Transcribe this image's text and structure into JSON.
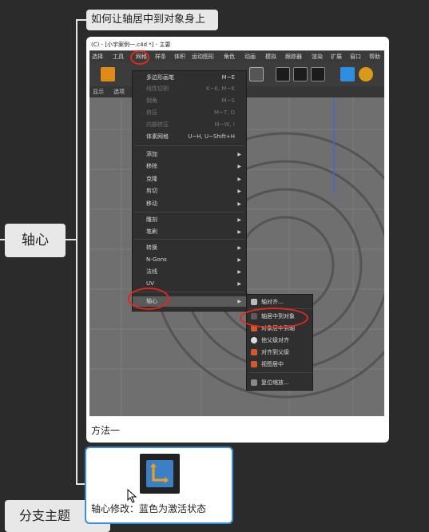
{
  "mindmap": {
    "title_node": "如何让轴居中到对象身上",
    "axis_node": "轴心",
    "branch_node": "分支主题",
    "card_caption": "方法一",
    "card2_caption": "轴心修改：蓝色为激活状态"
  },
  "screenshot": {
    "window_title": "(C) - [小宇案例一.c4d *] - 主要",
    "menubar": [
      "选择",
      "工具",
      "网格",
      "样条",
      "体积",
      "运动图形",
      "角色",
      "动画",
      "模拟",
      "跟踪器",
      "渲染",
      "扩展",
      "窗口",
      "帮助"
    ],
    "subbar": [
      "显示",
      "选项"
    ],
    "dropdown": {
      "items": [
        {
          "label": "多边形画笔",
          "shortcut": "M~E",
          "dim": false
        },
        {
          "label": "线性切割",
          "shortcut": "K~K, M~K",
          "dim": true
        },
        {
          "label": "倒角",
          "shortcut": "M~S",
          "dim": true
        },
        {
          "label": "挤压",
          "shortcut": "M~T, D",
          "dim": true
        },
        {
          "label": "内部挤压",
          "shortcut": "M~W, I",
          "dim": true
        },
        {
          "label": "体素网格",
          "shortcut": "U~H, U~Shift+H",
          "dim": false
        },
        {
          "label": "添加",
          "shortcut": "",
          "dim": false
        },
        {
          "label": "移除",
          "shortcut": "",
          "dim": false
        },
        {
          "label": "克隆",
          "shortcut": "",
          "dim": false
        },
        {
          "label": "剪切",
          "shortcut": "",
          "dim": false
        },
        {
          "label": "移动",
          "shortcut": "",
          "dim": false
        },
        {
          "label": "雕刻",
          "shortcut": "",
          "dim": false
        },
        {
          "label": "笔刷",
          "shortcut": "",
          "dim": false
        },
        {
          "label": "转换",
          "shortcut": "",
          "dim": false
        },
        {
          "label": "N-Gons",
          "shortcut": "",
          "dim": false
        },
        {
          "label": "法线",
          "shortcut": "",
          "dim": false
        },
        {
          "label": "UV",
          "shortcut": "",
          "dim": false
        },
        {
          "label": "轴心",
          "shortcut": "",
          "dim": false
        }
      ]
    },
    "submenu": {
      "items": [
        "轴对齐...",
        "轴居中到对象",
        "对象居中到轴",
        "他父级对齐",
        "对齐到父级",
        "视图居中",
        "复位缩放..."
      ]
    }
  },
  "colors": {
    "accent_blue": "#3a8fd6",
    "highlight_red": "#e0281e",
    "pivot_blue": "#3b7fc4"
  }
}
